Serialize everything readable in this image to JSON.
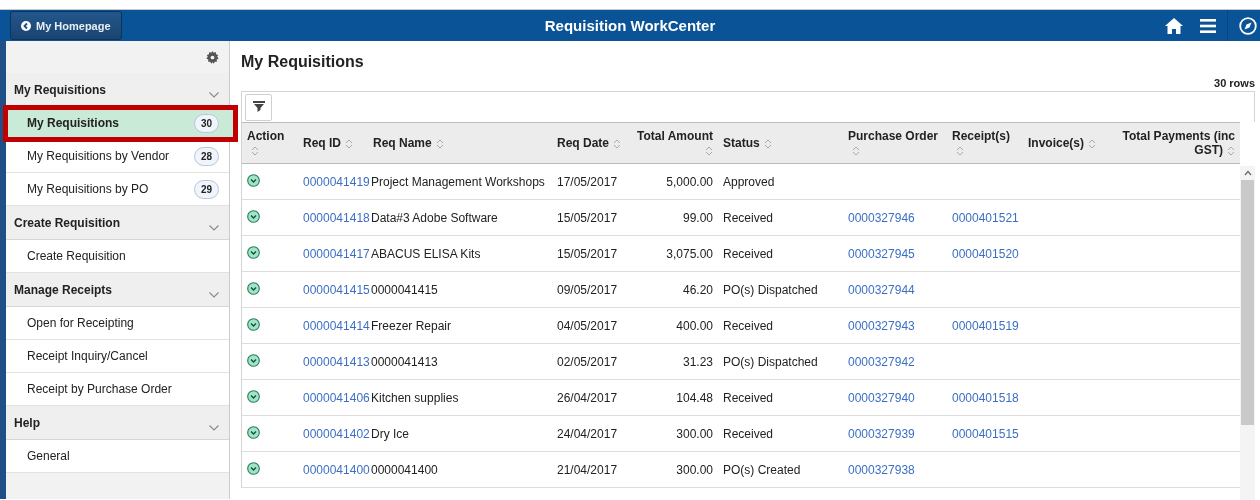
{
  "header": {
    "back_button": "My Homepage",
    "title": "Requisition WorkCenter"
  },
  "sidebar": {
    "sections": [
      {
        "title": "My Requisitions",
        "expanded": true,
        "items": [
          {
            "label": "My Requisitions",
            "count": "30",
            "selected": true,
            "highlight_frame": true
          },
          {
            "label": "My Requisitions by Vendor",
            "count": "28",
            "selected": false,
            "highlight_frame": false
          },
          {
            "label": "My Requisitions by PO",
            "count": "29",
            "selected": false,
            "highlight_frame": false
          }
        ]
      },
      {
        "title": "Create Requisition",
        "expanded": true,
        "items": [
          {
            "label": "Create Requisition",
            "selected": false,
            "highlight_frame": false
          }
        ]
      },
      {
        "title": "Manage Receipts",
        "expanded": true,
        "items": [
          {
            "label": "Open for Receipting",
            "selected": false,
            "highlight_frame": false
          },
          {
            "label": "Receipt Inquiry/Cancel",
            "selected": false,
            "highlight_frame": false
          },
          {
            "label": "Receipt by Purchase Order",
            "selected": false,
            "highlight_frame": false
          }
        ]
      },
      {
        "title": "Help",
        "expanded": true,
        "items": [
          {
            "label": "General",
            "selected": false,
            "highlight_frame": false
          }
        ]
      }
    ]
  },
  "main": {
    "title": "My Requisitions",
    "row_count": "30 rows",
    "table": {
      "columns": [
        {
          "label": "Action"
        },
        {
          "label": "Req ID"
        },
        {
          "label": "Req Name"
        },
        {
          "label": "Req Date"
        },
        {
          "label": "Total Amount"
        },
        {
          "label": "Status"
        },
        {
          "label": "Purchase Order"
        },
        {
          "label": "Receipt(s)"
        },
        {
          "label": "Invoice(s)"
        },
        {
          "label": "Total Payments (inc GST)"
        }
      ],
      "rows": [
        {
          "req_id": "0000041419",
          "req_name": "Project Management Workshops",
          "req_date": "17/05/2017",
          "total_amount": "5,000.00",
          "status": "Approved"
        },
        {
          "req_id": "0000041418",
          "req_name": "Data#3 Adobe Software",
          "req_date": "15/05/2017",
          "total_amount": "99.00",
          "status": "Received",
          "purchase_order": "0000327946",
          "receipts": "0000401521"
        },
        {
          "req_id": "0000041417",
          "req_name": "ABACUS ELISA Kits",
          "req_date": "15/05/2017",
          "total_amount": "3,075.00",
          "status": "Received",
          "purchase_order": "0000327945",
          "receipts": "0000401520"
        },
        {
          "req_id": "0000041415",
          "req_name": "0000041415",
          "req_date": "09/05/2017",
          "total_amount": "46.20",
          "status": "PO(s) Dispatched",
          "purchase_order": "0000327944"
        },
        {
          "req_id": "0000041414",
          "req_name": "Freezer Repair",
          "req_date": "04/05/2017",
          "total_amount": "400.00",
          "status": "Received",
          "purchase_order": "0000327943",
          "receipts": "0000401519"
        },
        {
          "req_id": "0000041413",
          "req_name": "0000041413",
          "req_date": "02/05/2017",
          "total_amount": "31.23",
          "status": "PO(s) Dispatched",
          "purchase_order": "0000327942"
        },
        {
          "req_id": "0000041406",
          "req_name": "Kitchen supplies",
          "req_date": "26/04/2017",
          "total_amount": "104.48",
          "status": "Received",
          "purchase_order": "0000327940",
          "receipts": "0000401518"
        },
        {
          "req_id": "0000041402",
          "req_name": "Dry Ice",
          "req_date": "24/04/2017",
          "total_amount": "300.00",
          "status": "Received",
          "purchase_order": "0000327939",
          "receipts": "0000401515"
        },
        {
          "req_id": "0000041400",
          "req_name": "0000041400",
          "req_date": "21/04/2017",
          "total_amount": "300.00",
          "status": "PO(s) Created",
          "purchase_order": "0000327938"
        }
      ]
    }
  }
}
